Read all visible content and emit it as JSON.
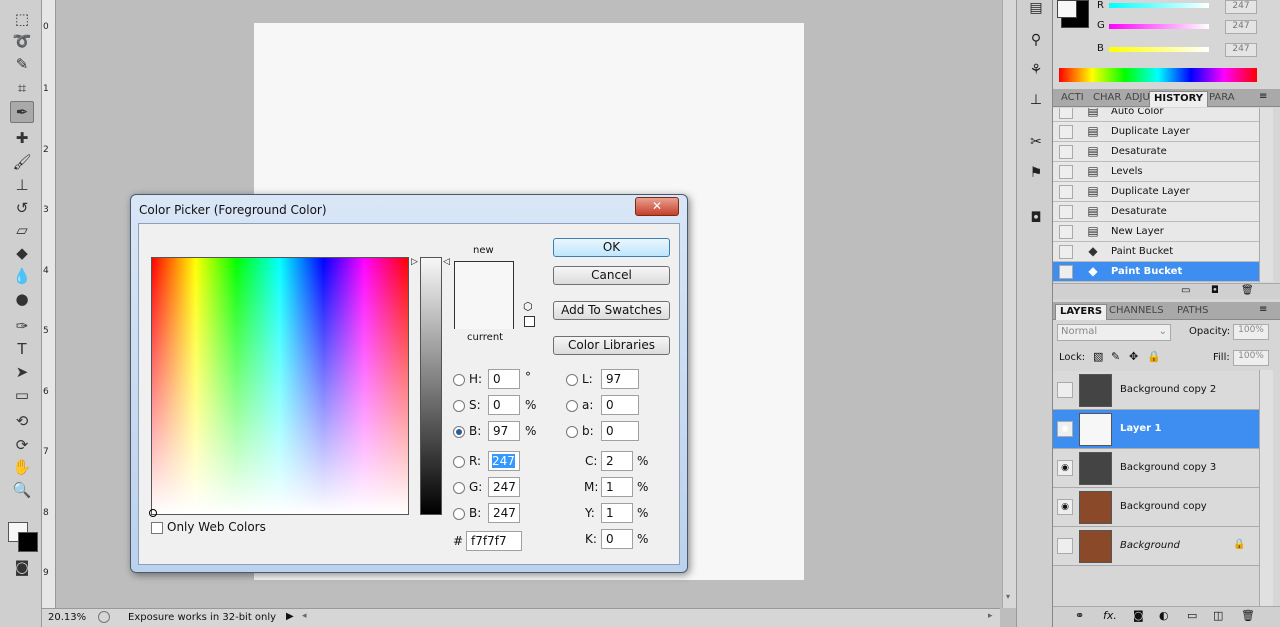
{
  "status": {
    "zoom": "20.13%",
    "message": "Exposure works in 32-bit only"
  },
  "ruler": {
    "ticks": [
      "0",
      "1",
      "2",
      "3",
      "4",
      "5",
      "6",
      "7",
      "8",
      "9"
    ]
  },
  "color_panel": {
    "r": "247",
    "g": "247",
    "b": "247",
    "r_label": "R",
    "g_label": "G",
    "b_label": "B"
  },
  "history": {
    "tabs": [
      "ACTI",
      "CHAR",
      "ADJU",
      "HISTORY",
      "PARA"
    ],
    "items": [
      "Auto Color",
      "Duplicate Layer",
      "Desaturate",
      "Levels",
      "Duplicate Layer",
      "Desaturate",
      "New Layer",
      "Paint Bucket",
      "Paint Bucket"
    ],
    "selected_index": 8
  },
  "layers": {
    "tabs": [
      "LAYERS",
      "CHANNELS",
      "PATHS"
    ],
    "blend_mode": "Normal",
    "opacity_label": "Opacity:",
    "opacity": "100%",
    "lock_label": "Lock:",
    "fill_label": "Fill:",
    "fill": "100%",
    "items": [
      {
        "name": "Background copy 2",
        "visible": false
      },
      {
        "name": "Layer 1",
        "visible": true
      },
      {
        "name": "Background copy 3",
        "visible": true
      },
      {
        "name": "Background copy",
        "visible": true
      },
      {
        "name": "Background",
        "visible": false
      }
    ],
    "selected_index": 1
  },
  "dialog": {
    "title": "Color Picker (Foreground Color)",
    "close": "✕",
    "new_label": "new",
    "current_label": "current",
    "buttons": {
      "ok": "OK",
      "cancel": "Cancel",
      "add_swatches": "Add To Swatches",
      "libraries": "Color Libraries"
    },
    "only_web": "Only Web Colors",
    "fields": {
      "H": {
        "label": "H:",
        "value": "0",
        "unit": "°"
      },
      "S": {
        "label": "S:",
        "value": "0",
        "unit": "%"
      },
      "Bv": {
        "label": "B:",
        "value": "97",
        "unit": "%"
      },
      "R": {
        "label": "R:",
        "value": "247"
      },
      "G": {
        "label": "G:",
        "value": "247"
      },
      "Bc": {
        "label": "B:",
        "value": "247"
      },
      "L": {
        "label": "L:",
        "value": "97"
      },
      "a": {
        "label": "a:",
        "value": "0"
      },
      "b": {
        "label": "b:",
        "value": "0"
      },
      "C": {
        "label": "C:",
        "value": "2",
        "unit": "%"
      },
      "M": {
        "label": "M:",
        "value": "1",
        "unit": "%"
      },
      "Y": {
        "label": "Y:",
        "value": "1",
        "unit": "%"
      },
      "K": {
        "label": "K:",
        "value": "0",
        "unit": "%"
      }
    },
    "hex_label": "#",
    "hex": "f7f7f7",
    "color_hex": "#f7f7f7"
  }
}
